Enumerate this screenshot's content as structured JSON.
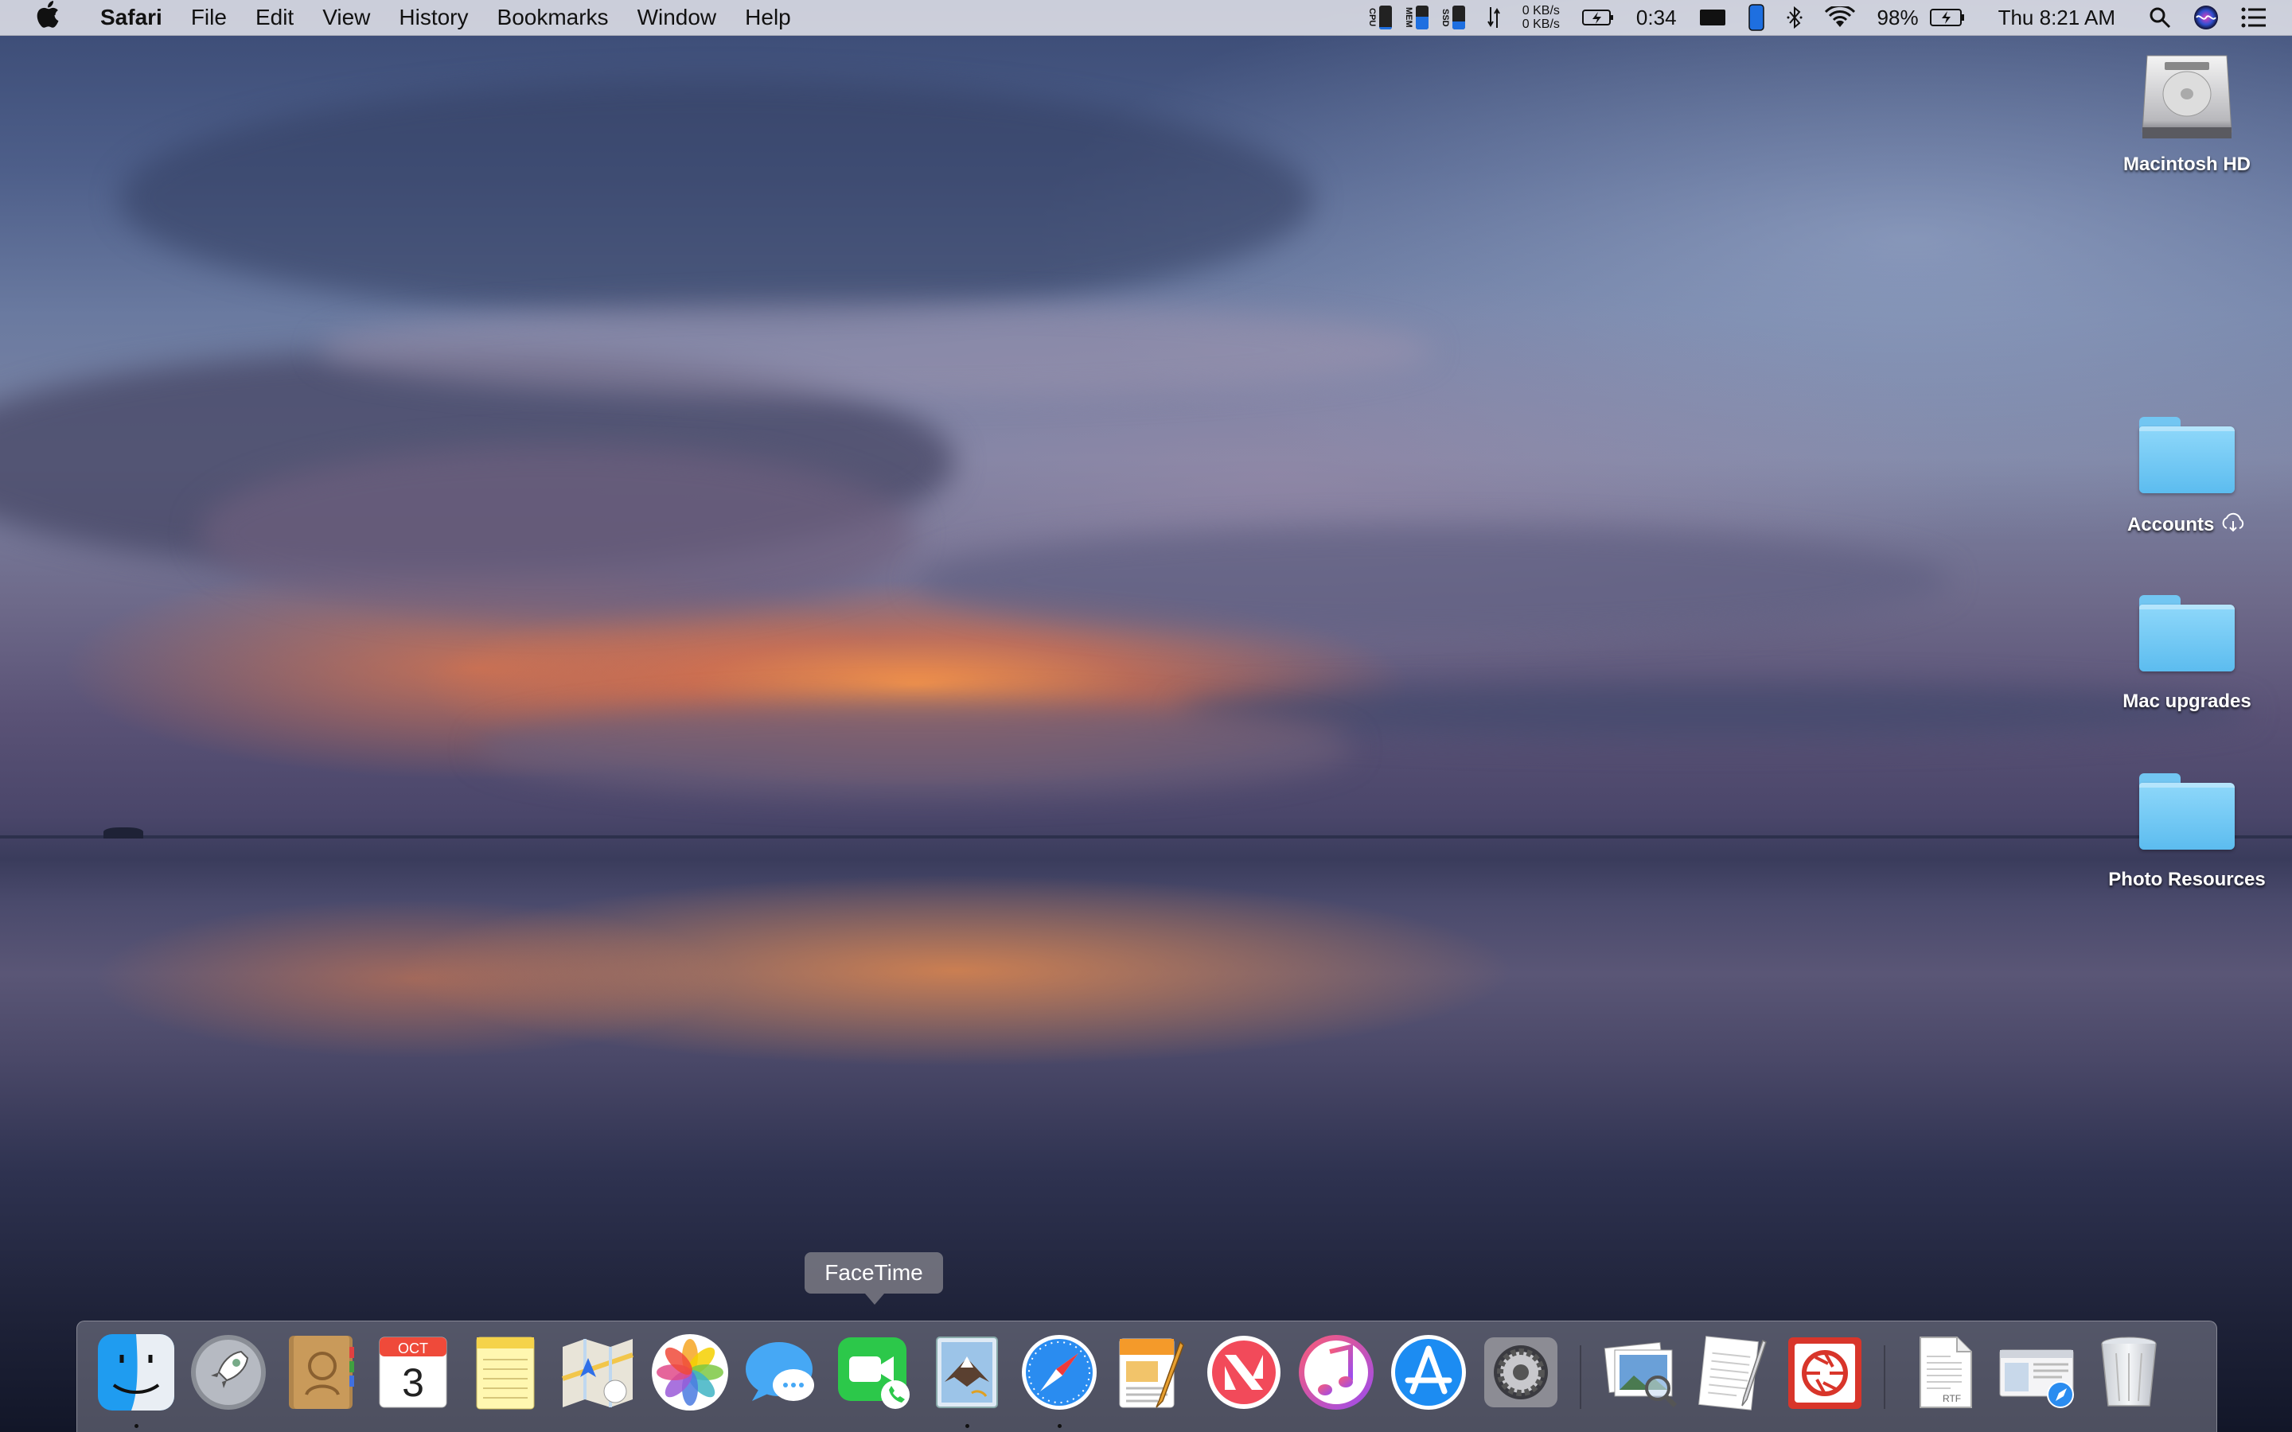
{
  "menubar": {
    "app_name": "Safari",
    "menus": [
      "File",
      "Edit",
      "View",
      "History",
      "Bookmarks",
      "Window",
      "Help"
    ],
    "stats": [
      {
        "label": "CPU",
        "level": 0.1
      },
      {
        "label": "MEM",
        "level": 0.55
      },
      {
        "label": "SSD",
        "level": 0.35
      }
    ],
    "network": {
      "up": "0 KB/s",
      "down": "0 KB/s"
    },
    "battery_time": "0:34",
    "battery_percent": "98%",
    "clock": "Thu 8:21 AM",
    "icons": [
      "apple-icon",
      "network-arrows-icon",
      "battery-charging-icon",
      "display-icon",
      "phone-icon",
      "bluetooth-icon",
      "wifi-icon",
      "search-icon",
      "siri-icon",
      "notification-center-icon"
    ]
  },
  "desktop": {
    "items": [
      {
        "label": "Macintosh HD",
        "icon": "hard-drive-icon"
      },
      {
        "label": "Accounts",
        "icon": "folder-icon",
        "badge": "icloud-download-icon"
      },
      {
        "label": "Mac upgrades",
        "icon": "folder-icon"
      },
      {
        "label": "Photo Resources",
        "icon": "folder-icon"
      }
    ]
  },
  "dock": {
    "tooltip": "FaceTime",
    "apps": [
      {
        "name": "Finder",
        "icon": "finder-icon",
        "running": true
      },
      {
        "name": "Launchpad",
        "icon": "launchpad-icon",
        "running": false
      },
      {
        "name": "Contacts",
        "icon": "contacts-icon",
        "running": false
      },
      {
        "name": "Calendar",
        "icon": "calendar-icon",
        "running": false,
        "month": "OCT",
        "day": "3"
      },
      {
        "name": "Notes",
        "icon": "notes-icon",
        "running": false
      },
      {
        "name": "Maps",
        "icon": "maps-icon",
        "running": false
      },
      {
        "name": "Photos",
        "icon": "photos-icon",
        "running": false
      },
      {
        "name": "Messages",
        "icon": "messages-icon",
        "running": false
      },
      {
        "name": "FaceTime",
        "icon": "facetime-icon",
        "running": false
      },
      {
        "name": "Mail",
        "icon": "mail-icon",
        "running": true
      },
      {
        "name": "Safari",
        "icon": "safari-icon",
        "running": true
      },
      {
        "name": "Pages",
        "icon": "pages-icon",
        "running": false
      },
      {
        "name": "News",
        "icon": "news-icon",
        "running": false
      },
      {
        "name": "iTunes",
        "icon": "itunes-icon",
        "running": false
      },
      {
        "name": "App Store",
        "icon": "app-store-icon",
        "running": false
      },
      {
        "name": "System Preferences",
        "icon": "system-preferences-icon",
        "running": false
      },
      {
        "name": "Preview",
        "icon": "preview-icon",
        "running": false
      },
      {
        "name": "TextEdit",
        "icon": "textedit-icon",
        "running": false
      },
      {
        "name": "Screenshot",
        "icon": "screenshot-app-icon",
        "running": false
      },
      {
        "name": "Document",
        "icon": "rtf-document-icon",
        "running": false,
        "label": "RTF"
      },
      {
        "name": "Safari Downloads",
        "icon": "downloads-stack-icon",
        "running": false
      },
      {
        "name": "Trash",
        "icon": "trash-icon",
        "running": false
      }
    ]
  }
}
